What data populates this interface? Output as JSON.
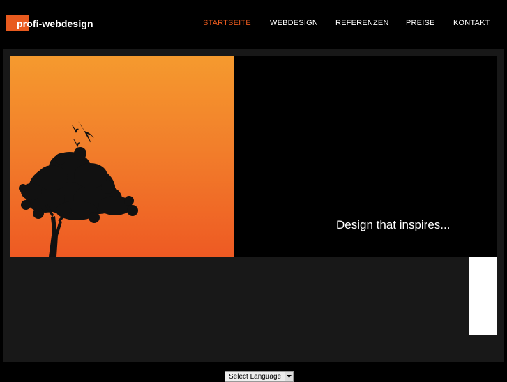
{
  "header": {
    "logo_text": "profi-webdesign",
    "nav": [
      {
        "label": "STARTSEITE",
        "active": true
      },
      {
        "label": "WEBDESIGN",
        "active": false
      },
      {
        "label": "REFERENZEN",
        "active": false
      },
      {
        "label": "PREISE",
        "active": false
      },
      {
        "label": "KONTAKT",
        "active": false
      }
    ]
  },
  "hero": {
    "tagline": "Design that inspires..."
  },
  "footer": {
    "language_select": "Select Language"
  },
  "colors": {
    "accent": "#e85a1e",
    "background": "#000000",
    "panel": "#181818"
  },
  "icons": {
    "language_dropdown": "chevron-down-icon"
  }
}
